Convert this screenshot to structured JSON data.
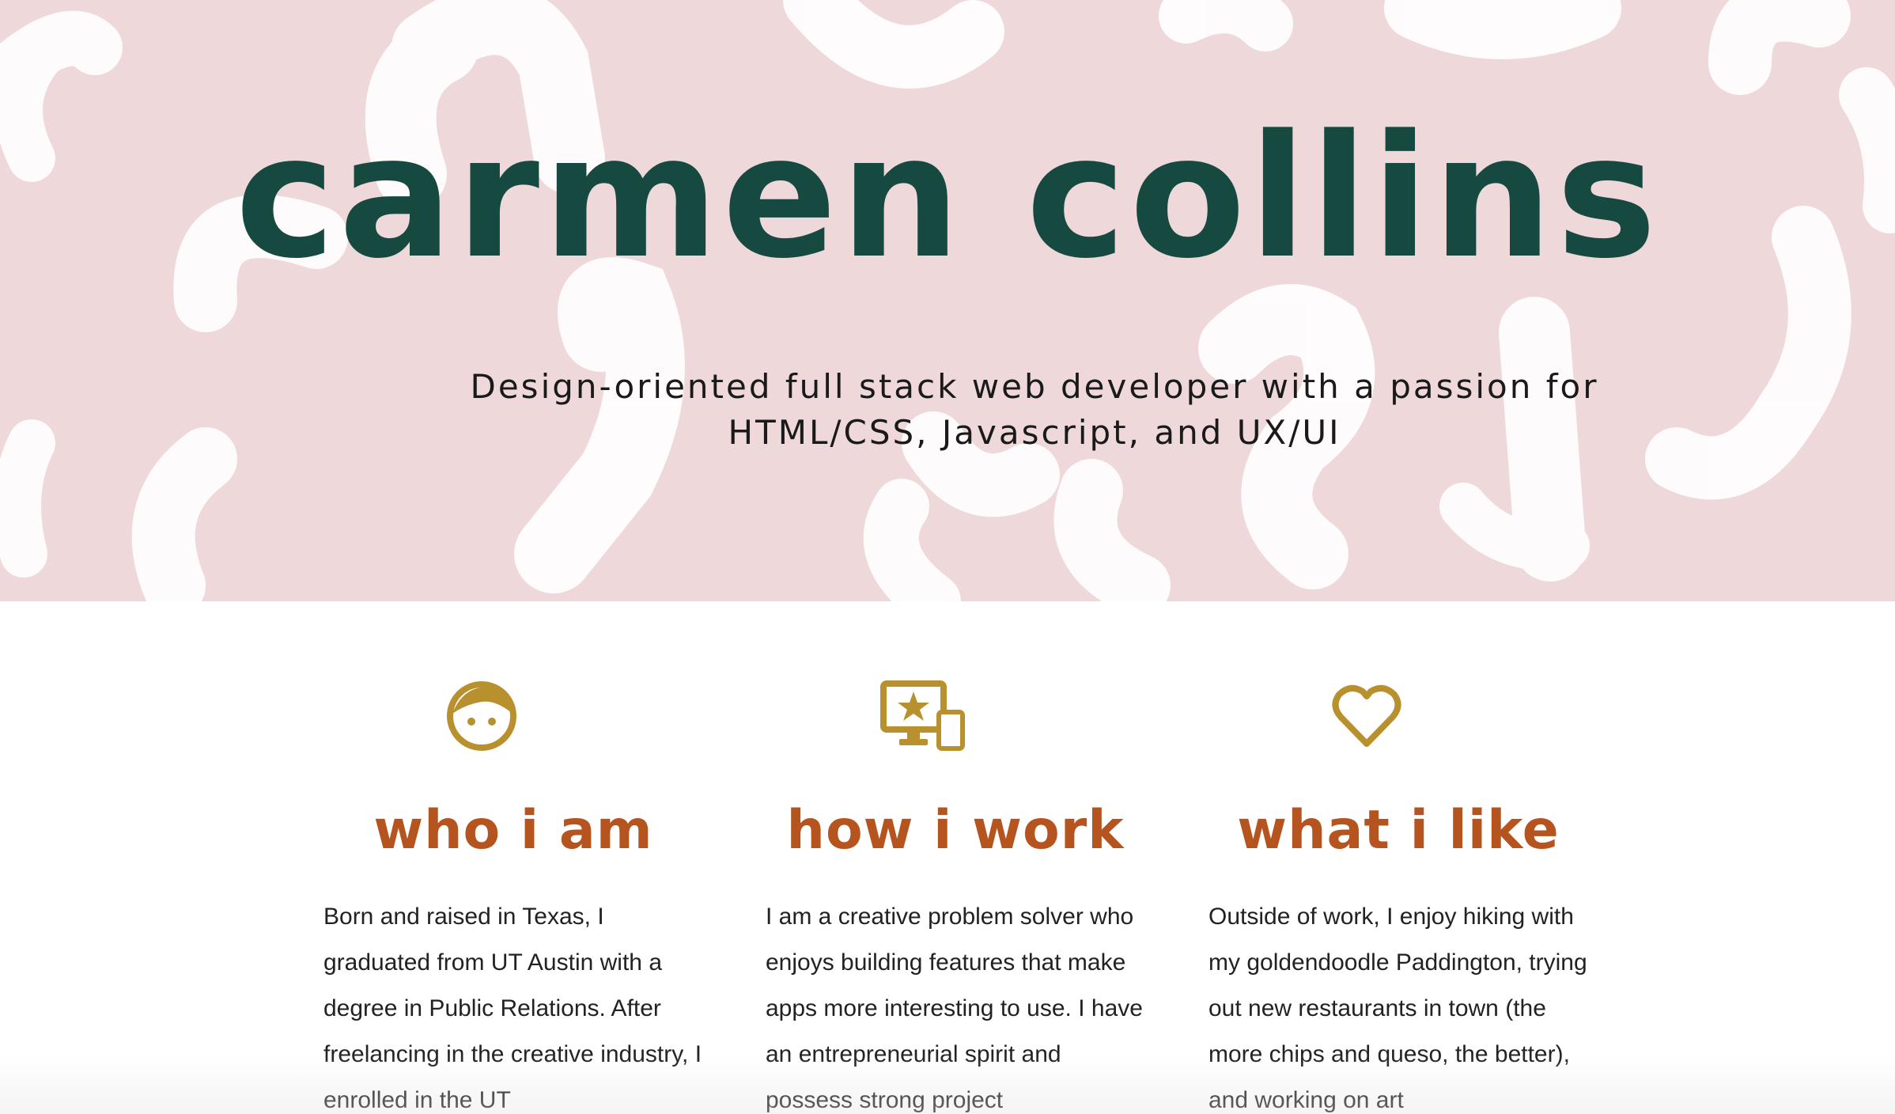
{
  "hero": {
    "title": "carmen collins",
    "tagline": "Design-oriented full stack web developer with a passion for HTML/CSS, Javascript, and UX/UI"
  },
  "colors": {
    "hero_background": "#efd8da",
    "title": "#164a41",
    "heading": "#b5541e",
    "icon": "#b8902e"
  },
  "features": [
    {
      "icon": "face-icon",
      "heading": "who i am",
      "body": "Born and raised in Texas, I graduated from UT Austin with a degree in Public Relations. After freelancing in the creative industry, I enrolled in the UT"
    },
    {
      "icon": "devices-star-icon",
      "heading": "how i work",
      "body": "I am a creative problem solver who enjoys building features that make apps more interesting to use. I have an entrepreneurial spirit and possess strong project"
    },
    {
      "icon": "heart-icon",
      "heading": "what i like",
      "body": "Outside of work, I enjoy hiking with my goldendoodle Paddington, trying out new restaurants in town (the more chips and queso, the better), and working on art"
    }
  ]
}
